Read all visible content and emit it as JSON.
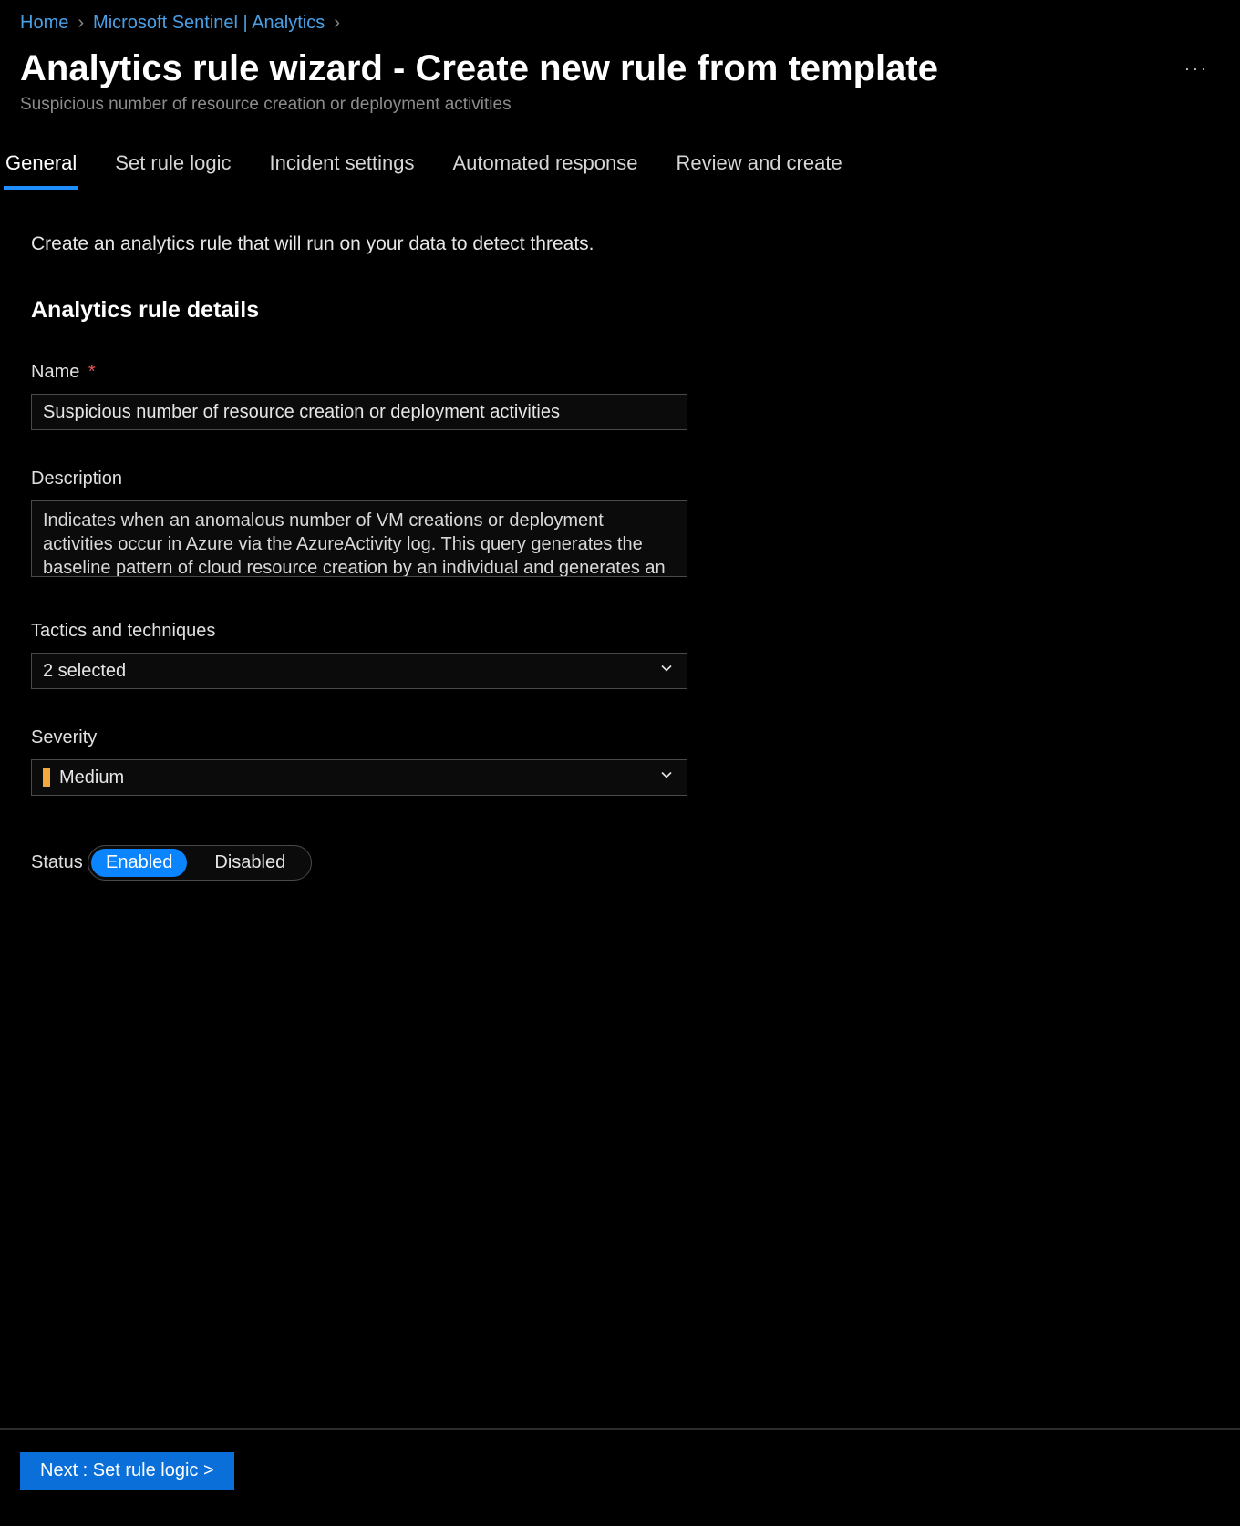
{
  "breadcrumb": {
    "items": [
      {
        "label": "Home"
      },
      {
        "label": "Microsoft Sentinel | Analytics"
      }
    ]
  },
  "header": {
    "title": "Analytics rule wizard - Create new rule from template",
    "subtitle": "Suspicious number of resource creation or deployment activities"
  },
  "tabs": [
    {
      "label": "General",
      "active": true
    },
    {
      "label": "Set rule logic",
      "active": false
    },
    {
      "label": "Incident settings",
      "active": false
    },
    {
      "label": "Automated response",
      "active": false
    },
    {
      "label": "Review and create",
      "active": false
    }
  ],
  "intro": "Create an analytics rule that will run on your data to detect threats.",
  "section_title": "Analytics rule details",
  "fields": {
    "name": {
      "label": "Name",
      "required_mark": "*",
      "value": "Suspicious number of resource creation or deployment activities"
    },
    "description": {
      "label": "Description",
      "value": "Indicates when an anomalous number of VM creations or deployment activities occur in Azure via the AzureActivity log. This query generates the baseline pattern of cloud resource creation by an individual and generates an anomaly"
    },
    "tactics": {
      "label": "Tactics and techniques",
      "selected_text": "2 selected"
    },
    "severity": {
      "label": "Severity",
      "value": "Medium",
      "color": "#f2a93b"
    },
    "status": {
      "label": "Status",
      "options": [
        "Enabled",
        "Disabled"
      ],
      "active": "Enabled"
    }
  },
  "footer": {
    "next_label": "Next : Set rule logic >"
  }
}
